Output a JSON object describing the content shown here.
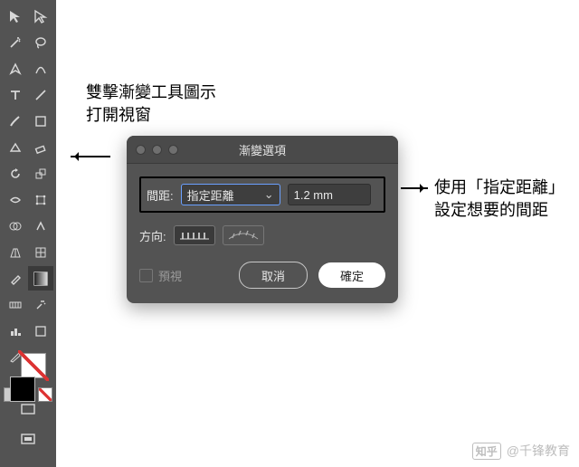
{
  "annotations": {
    "top_line1": "雙擊漸變工具圖示",
    "top_line2": "打開視窗",
    "right_line1": "使用「指定距離」",
    "right_line2": "設定想要的間距"
  },
  "dialog": {
    "title": "漸變選項",
    "spacing_label": "間距:",
    "spacing_mode": "指定距離",
    "spacing_value": "1.2 mm",
    "orientation_label": "方向:",
    "preview_label": "預視",
    "cancel_label": "取消",
    "ok_label": "確定"
  },
  "toolbox_tools": [
    [
      "selection",
      "direct-selection"
    ],
    [
      "magic-wand",
      "lasso"
    ],
    [
      "pen",
      "curvature-pen"
    ],
    [
      "type",
      "line-segment"
    ],
    [
      "paintbrush",
      "blob-brush"
    ],
    [
      "shaper",
      "eraser"
    ],
    [
      "rotate",
      "scale"
    ],
    [
      "width",
      "free-transform"
    ],
    [
      "shape-builder",
      "live-paint"
    ],
    [
      "perspective",
      "mesh"
    ],
    [
      "gradient",
      "eyedropper"
    ],
    [
      "blend",
      "symbol-sprayer"
    ],
    [
      "column-graph",
      "artboard"
    ],
    [
      "slice",
      "hand"
    ]
  ],
  "bottom_icons": [
    "screen-mode",
    "change-screen"
  ],
  "watermark": {
    "brand": "知乎",
    "author": "@千锋教育"
  }
}
